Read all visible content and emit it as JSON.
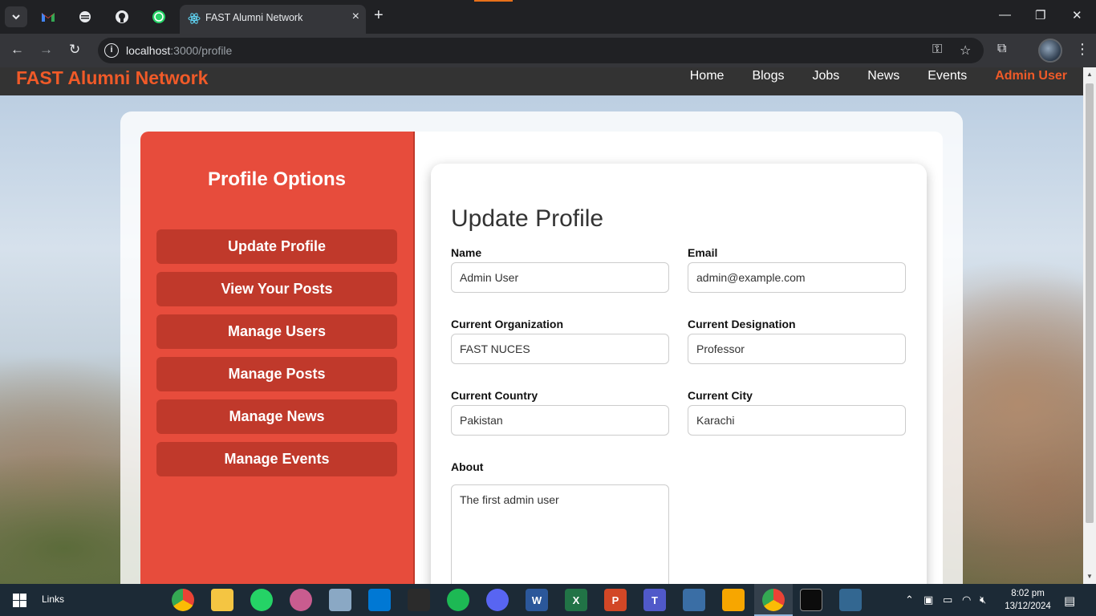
{
  "browser": {
    "tab_title": "FAST Alumni Network",
    "url_host": "localhost",
    "url_path": ":3000/profile",
    "new_tab_label": "+",
    "close_tab_label": "×"
  },
  "site": {
    "brand": "FAST Alumni Network",
    "nav": [
      {
        "label": "Home"
      },
      {
        "label": "Blogs"
      },
      {
        "label": "Jobs"
      },
      {
        "label": "News"
      },
      {
        "label": "Events"
      },
      {
        "label": "Admin User"
      }
    ]
  },
  "sidebar": {
    "title": "Profile Options",
    "items": [
      {
        "label": "Update Profile"
      },
      {
        "label": "View Your Posts"
      },
      {
        "label": "Manage Users"
      },
      {
        "label": "Manage Posts"
      },
      {
        "label": "Manage News"
      },
      {
        "label": "Manage Events"
      }
    ]
  },
  "form": {
    "title": "Update Profile",
    "name_label": "Name",
    "name_value": "Admin User",
    "email_label": "Email",
    "email_value": "admin@example.com",
    "org_label": "Current Organization",
    "org_value": "FAST NUCES",
    "designation_label": "Current Designation",
    "designation_value": "Professor",
    "country_label": "Current Country",
    "country_value": "Pakistan",
    "city_label": "Current City",
    "city_value": "Karachi",
    "about_label": "About",
    "about_value": "The first admin user"
  },
  "taskbar": {
    "links_label": "Links",
    "time": "8:02 pm",
    "date": "13/12/2024"
  },
  "colors": {
    "brand_orange": "#f05a28",
    "sidebar_red": "#e74c3c",
    "sidebar_button": "#c0392b"
  }
}
